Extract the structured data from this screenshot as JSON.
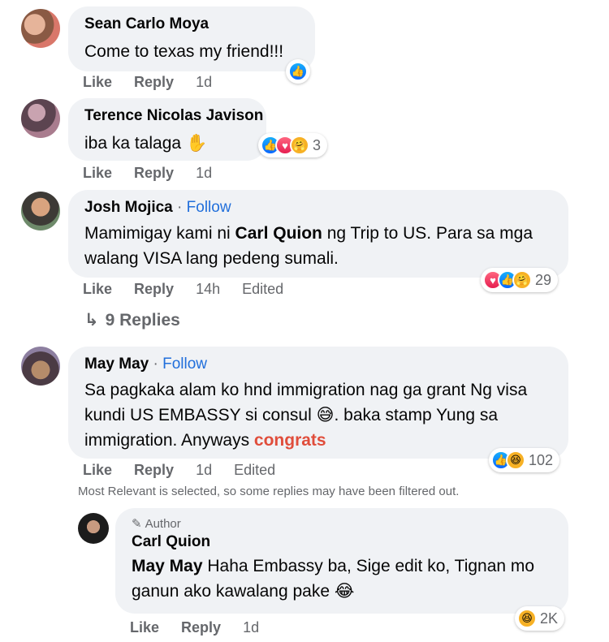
{
  "comments": [
    {
      "name": "Sean Carlo Moya",
      "text": "Come to texas my friend!!!",
      "actions": {
        "like": "Like",
        "reply": "Reply",
        "time": "1d"
      }
    },
    {
      "name": "Terence Nicolas Javison",
      "text": "iba ka talaga",
      "reactions_count": "3",
      "actions": {
        "like": "Like",
        "reply": "Reply",
        "time": "1d"
      }
    },
    {
      "name": "Josh Mojica",
      "follow": "Follow",
      "text_before": "Mamimigay kami ni ",
      "mention": "Carl Quion",
      "text_after": " ng Trip to US. Para sa mga walang VISA lang pedeng sumali.",
      "reactions_count": "29",
      "actions": {
        "like": "Like",
        "reply": "Reply",
        "time": "14h",
        "edited": "Edited"
      },
      "replies_label": "9 Replies"
    },
    {
      "name": "May May",
      "follow": "Follow",
      "text_before": "Sa pagkaka alam ko hnd immigration nag ga grant Ng visa kundi US EMBASSY si consul ",
      "text_mid": ". baka stamp Yung sa immigration. Anyways ",
      "highlight": "congrats",
      "reactions_count": "102",
      "actions": {
        "like": "Like",
        "reply": "Reply",
        "time": "1d",
        "edited": "Edited"
      }
    }
  ],
  "filter_note": "Most Relevant is selected, so some replies may have been filtered out.",
  "reply": {
    "author_tag": "Author",
    "name": "Carl Quion",
    "mention": "May May",
    "text": " Haha Embassy ba, Sige edit ko, Tignan mo ganun ako kawalang pake ",
    "reactions_count": "2K",
    "actions": {
      "like": "Like",
      "reply": "Reply",
      "time": "1d"
    }
  },
  "icons": {
    "like": "like-reaction-icon",
    "love": "love-reaction-icon",
    "care": "care-reaction-icon",
    "haha": "haha-reaction-icon",
    "reply_arrow": "reply-arrow-icon",
    "pencil": "pencil-icon"
  },
  "colors": {
    "link": "#216fdb",
    "secondary": "#65676b",
    "bubble": "#f0f2f5",
    "congrats": "#e04d3b"
  }
}
